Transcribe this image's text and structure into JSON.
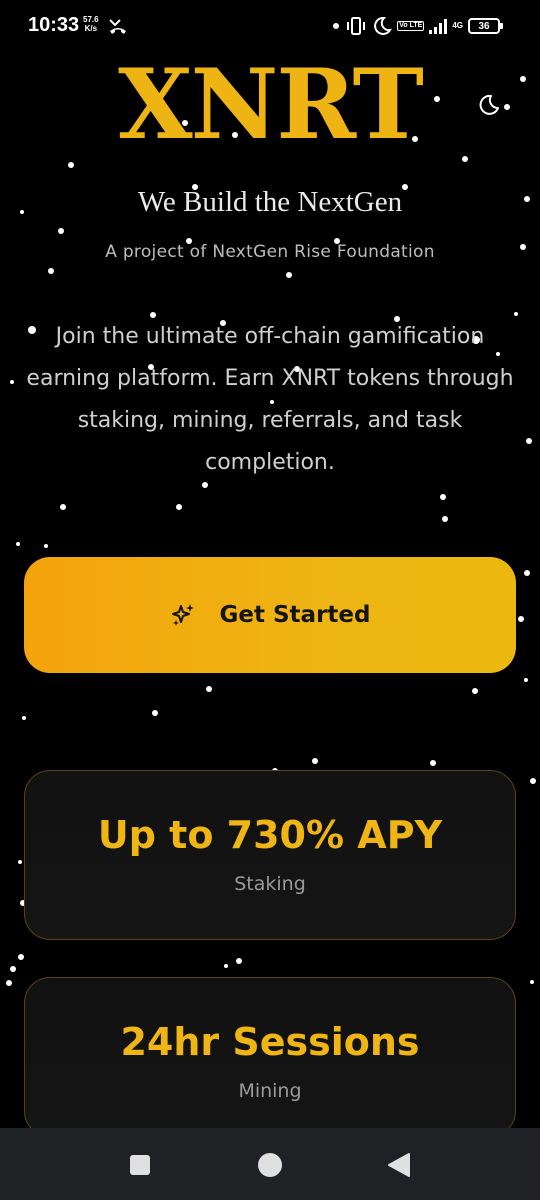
{
  "status_bar": {
    "time": "10:33",
    "speed_value": "57.6",
    "speed_unit": "K/s",
    "net_type": "4G",
    "lte_label": "Vo LTE",
    "battery": "36"
  },
  "hero": {
    "brand": "XNRT",
    "tagline": "We Build the NextGen",
    "subtag": "A project of NextGen Rise Foundation",
    "intro": "Join the ultimate off-chain gamification earning platform. Earn XNRT tokens through staking, mining, referrals, and task completion."
  },
  "cta": {
    "label": "Get Started",
    "icon": "sparkles-icon"
  },
  "stats": [
    {
      "value": "Up to 730% APY",
      "label": "Staking"
    },
    {
      "value": "24hr Sessions",
      "label": "Mining"
    }
  ],
  "colors": {
    "accent": "#eeb514",
    "background": "#000000",
    "card_border": "#5a4217",
    "nav_bar": "#1f2124"
  },
  "icons": {
    "theme_toggle": "moon-icon",
    "nav_recents": "square-icon",
    "nav_home": "circle-icon",
    "nav_back": "triangle-back-icon"
  }
}
